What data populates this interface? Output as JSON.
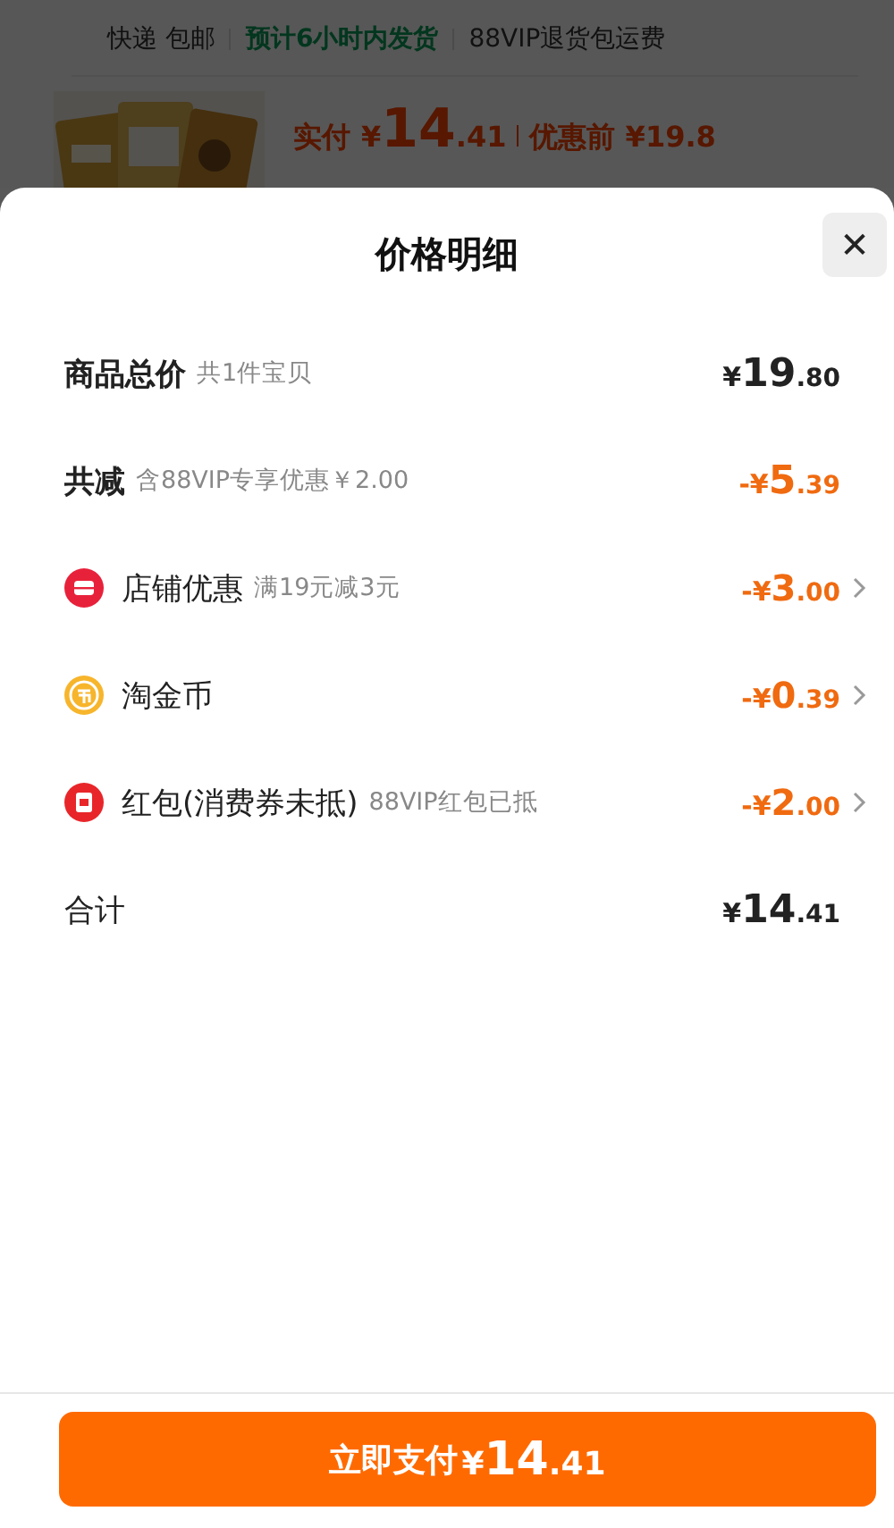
{
  "background_page": {
    "shipping_tags": [
      {
        "text": "快递 包邮",
        "kind": "plain"
      },
      {
        "text": "预计6小时内发货",
        "kind": "highlight"
      },
      {
        "text": "88VIP退货包运费",
        "kind": "plain"
      }
    ],
    "product": {
      "paid_label": "实付",
      "paid_price": {
        "prefix": "¥",
        "major": "14",
        "minor": ".41"
      },
      "original_label": "优惠前 ¥19.8"
    }
  },
  "sheet": {
    "title": "价格明细",
    "close_label": "✕",
    "rows": [
      {
        "kind": "total",
        "label": "商品总价",
        "note": "共1件宝贝",
        "amount": {
          "prefix": "¥",
          "major": "19",
          "minor": ".80"
        },
        "has_detail": false
      },
      {
        "kind": "discount",
        "label": "共减",
        "note": "含88VIP专享优惠￥2.00",
        "amount": {
          "prefix": "-¥",
          "major": "5",
          "minor": ".39"
        },
        "has_detail": false
      },
      {
        "kind": "shop",
        "label": "店铺优惠",
        "note": "满19元减3元",
        "amount": {
          "prefix": "-¥",
          "major": "3",
          "minor": ".00"
        },
        "has_detail": true
      },
      {
        "kind": "coin",
        "label": "淘金币",
        "amount": {
          "prefix": "-¥",
          "major": "0",
          "minor": ".39"
        },
        "has_detail": true
      },
      {
        "kind": "packet",
        "label": "红包(消费券未抵)",
        "note": "88VIP红包已抵",
        "amount": {
          "prefix": "-¥",
          "major": "2",
          "minor": ".00"
        },
        "has_detail": true
      },
      {
        "kind": "sum",
        "label": "合计",
        "amount": {
          "prefix": "¥",
          "major": "14",
          "minor": ".41"
        },
        "has_detail": false
      }
    ],
    "pay_button": {
      "label": "立即支付",
      "amount": {
        "prefix": "¥",
        "major": "14",
        "minor": ".41"
      }
    }
  }
}
